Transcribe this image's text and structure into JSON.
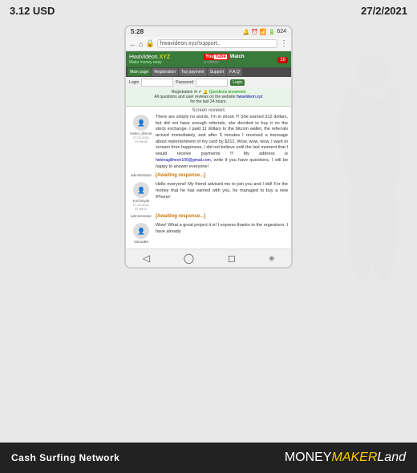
{
  "topBar": {
    "left": "3.12 USD",
    "right": "27/2/2021"
  },
  "statusBar": {
    "time": "5:28",
    "icons": "🔔 ⏰ △ :",
    "right": "📶 📶 🔋 624"
  },
  "browserBar": {
    "url": "hwavideon.xyz/support..",
    "icons": "← ■ 🔒",
    "menu": "⋮"
  },
  "siteHeader": {
    "logoHwa": "Hwa",
    "logoVideon": "Videon",
    "logoXyz": ".XYZ",
    "tagline": "Make money easy",
    "youtubeLabel": "You",
    "tubeLabel": "Tube",
    "watchLabel": "Watch",
    "perLabel": "a videos",
    "badgeNum": "38"
  },
  "navItems": [
    "Main page",
    "Registration",
    "Top payment",
    "Support",
    "F.A.Q"
  ],
  "loginBar": {
    "loginLabel": "Login",
    "passwordLabel": "Password",
    "loginBtn": "Login"
  },
  "infoBar": {
    "line1": "Registration ✉ ✔ 🔔 Questions answered",
    "line2": "All questions and user reviews on the website hwavideon.xyz",
    "line3": "for the last 24 hours.",
    "sectionTitle": "Screen reviews"
  },
  "reviews": [
    {
      "reviewer": "Helen_illmore",
      "date1": "27.02.2021",
      "date2": "07:59:06",
      "awaiting": "",
      "text": "There are simply no words, I'm in shock !!! She earned 312 dollars, but did not have enough referrals, she decided to buy it on the stock exchange. I paid 11 dollars to the bitcoin wallet, the referrals arrived immediately, and after 5 minutes I received a message about replenishment of my card by $312. Wow, wow, wow, I want to scream from happiness, I did not believe until the last moment that I would receive payments !!! My address is helenagillmore100@gmail.com, write if you have questions, I will be happy to answer everyone!",
      "email": "helenagillmore100@gmail.com",
      "hasAvatar": true
    },
    {
      "reviewer": "administrator",
      "date1": "",
      "date2": "",
      "awaiting": "[Awaiting response...]",
      "text": "",
      "hasAvatar": false
    },
    {
      "reviewer": "Kuchinyak",
      "date1": "27.02.2021",
      "date2": "07:59:57",
      "awaiting": "",
      "text": "Hello everyone! My friend advised me to join you and I did! For the money that he has earned with you, he managed to buy a new iPhone!",
      "hasAvatar": true
    },
    {
      "reviewer": "administrator",
      "date1": "",
      "date2": "",
      "awaiting": "[Awaiting response...]",
      "text": "",
      "hasAvatar": false
    },
    {
      "reviewer": "VanuaBe",
      "date1": "",
      "date2": "",
      "awaiting": "",
      "text": "Wow! What a great project it is! I express thanks to the organizers. I have already",
      "hasAvatar": true
    }
  ],
  "phoneNav": [
    "🏠",
    "◻",
    "◯",
    "◁"
  ],
  "bottomBar": {
    "left": "Cash Surfing Network",
    "moneyLabel": "MONEY",
    "makerLabel": "MAKER",
    "landLabel": "Land"
  }
}
